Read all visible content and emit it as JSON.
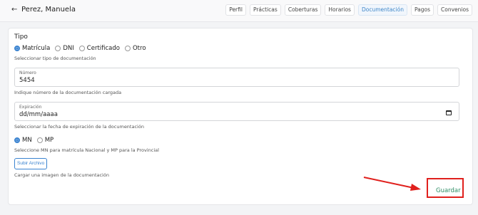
{
  "header": {
    "back_icon": "arrow-left-icon",
    "back_glyph": "←",
    "title": "Perez, Manuela",
    "tabs": [
      "Perfil",
      "Prácticas",
      "Coberturas",
      "Horarios",
      "Documentación",
      "Pagos",
      "Convenios"
    ],
    "active_tab": "Documentación"
  },
  "form": {
    "tipo_label": "Tipo",
    "tipo_options": [
      "Matrícula",
      "DNI",
      "Certificado",
      "Otro"
    ],
    "tipo_selected": "Matrícula",
    "tipo_help": "Seleccionar tipo de documentación",
    "numero_label": "Número",
    "numero_value": "5454",
    "numero_help": "Indique número de la documentación cargada",
    "expiracion_label": "Expiración",
    "expiracion_value": "dd/mm/aaaa",
    "expiracion_help": "Seleccionar la fecha de expiración de la documentación",
    "jurisdiccion_options": [
      "MN",
      "MP"
    ],
    "jurisdiccion_selected": "MN",
    "jurisdiccion_help": "Seleccione MN para matrícula Nacional y MP para la Provincial",
    "upload_label": "Subir Archivo",
    "upload_help": "Cargar una imagen de la documentación",
    "save_label": "Guardar"
  },
  "colors": {
    "accent": "#3a83d0",
    "save_text": "#2f8e66",
    "highlight": "#e0201d"
  }
}
